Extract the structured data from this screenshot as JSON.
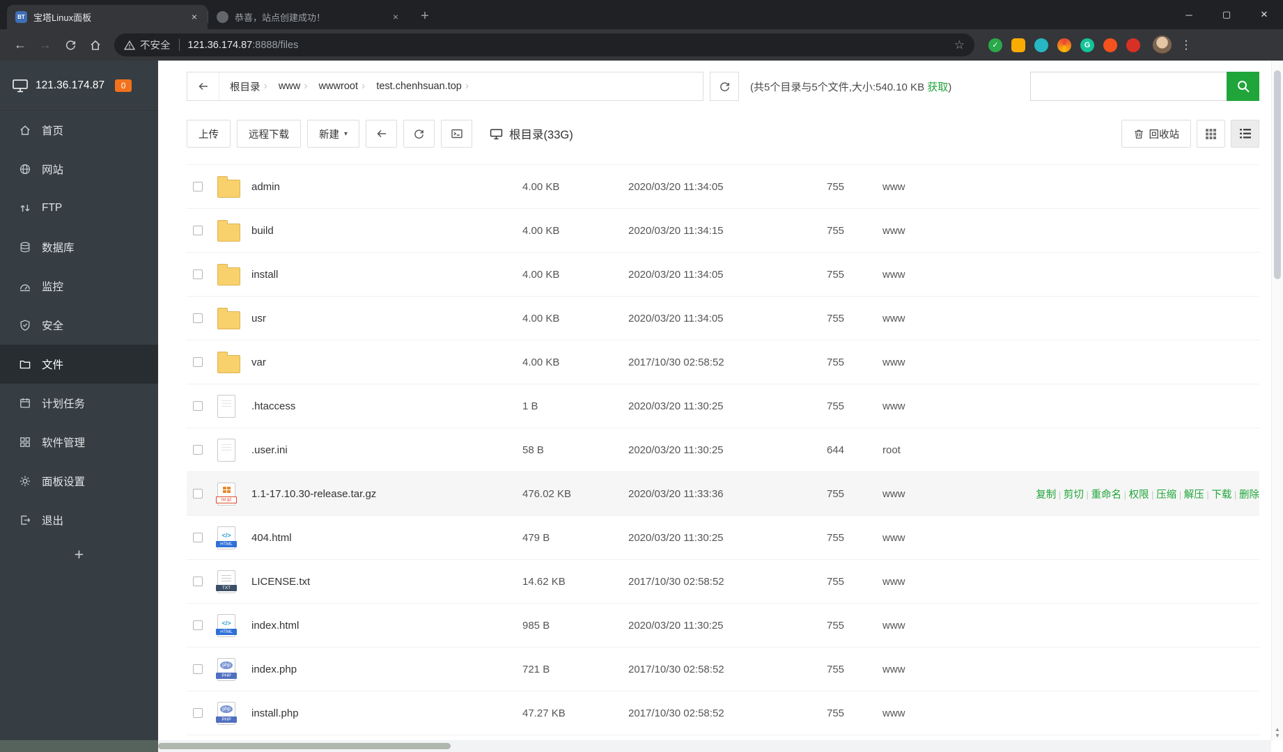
{
  "theme": {
    "accent_green": "#20a53a",
    "badge_orange": "#f2711c",
    "folder_yellow": "#f8d06c",
    "chrome_dark": "#202124",
    "sidebar_dark": "#373e43",
    "hover_row": "#f6f6f6"
  },
  "glyphs": {
    "back": "←",
    "forward": "→",
    "star": "☆",
    "kebab": "⋮",
    "minimize": "─",
    "maximize": "▢",
    "close": "✕",
    "tab_close": "×",
    "new_tab": "+",
    "caret": "▾",
    "crumb_sep": "›",
    "check": "✓",
    "g": "G",
    "bt": "BT",
    "scroll_up": "▲",
    "scroll_down": "▼"
  },
  "icons": {
    "search-icon": "magnifier",
    "recycle-icon": "trash-can",
    "not-secure-warning-icon": "triangle-exclamation",
    "grid-view-icon": "grid-3x3",
    "list-view-icon": "list-lines",
    "terminal-icon": "terminal-window",
    "disk-icon": "computer-drive",
    "refresh-icon": "circular-arrow"
  },
  "browser": {
    "tabs": [
      {
        "label": "宝塔Linux面板"
      },
      {
        "label": "恭喜，站点创建成功！"
      }
    ],
    "security_label": "不安全",
    "url_host": "121.36.174.87",
    "url_path": ":8888/files"
  },
  "sidebar": {
    "server_ip": "121.36.174.87",
    "message_count": "0",
    "items": [
      {
        "label": "首页"
      },
      {
        "label": "网站"
      },
      {
        "label": "FTP"
      },
      {
        "label": "数据库"
      },
      {
        "label": "监控"
      },
      {
        "label": "安全"
      },
      {
        "label": "文件"
      },
      {
        "label": "计划任务"
      },
      {
        "label": "软件管理"
      },
      {
        "label": "面板设置"
      },
      {
        "label": "退出"
      }
    ],
    "add_button": "+"
  },
  "pathbar": {
    "crumbs": [
      "根目录",
      "www",
      "wwwroot",
      "test.chenhsuan.top"
    ],
    "stats_prefix": "(共5个目录与5个文件,大小:540.10 KB ",
    "stats_link": "获取",
    "stats_suffix": ")"
  },
  "toolbar": {
    "upload": "上传",
    "remote_download": "远程下载",
    "new_menu": "新建",
    "root_disk": "根目录(33G)",
    "recycle_bin": "回收站"
  },
  "files": {
    "row_actions": [
      "复制",
      "剪切",
      "重命名",
      "权限",
      "压缩",
      "解压",
      "下载",
      "删除"
    ],
    "rows": [
      {
        "name": "admin",
        "size": "4.00 KB",
        "mtime": "2020/03/20 11:34:05",
        "perm": "755",
        "owner": "www"
      },
      {
        "name": "build",
        "size": "4.00 KB",
        "mtime": "2020/03/20 11:34:15",
        "perm": "755",
        "owner": "www"
      },
      {
        "name": "install",
        "size": "4.00 KB",
        "mtime": "2020/03/20 11:34:05",
        "perm": "755",
        "owner": "www"
      },
      {
        "name": "usr",
        "size": "4.00 KB",
        "mtime": "2020/03/20 11:34:05",
        "perm": "755",
        "owner": "www"
      },
      {
        "name": "var",
        "size": "4.00 KB",
        "mtime": "2017/10/30 02:58:52",
        "perm": "755",
        "owner": "www"
      },
      {
        "name": ".htaccess",
        "size": "1 B",
        "mtime": "2020/03/20 11:30:25",
        "perm": "755",
        "owner": "www"
      },
      {
        "name": ".user.ini",
        "size": "58 B",
        "mtime": "2020/03/20 11:30:25",
        "perm": "644",
        "owner": "root"
      },
      {
        "name": "1.1-17.10.30-release.tar.gz",
        "size": "476.02 KB",
        "mtime": "2020/03/20 11:33:36",
        "perm": "755",
        "owner": "www"
      },
      {
        "name": "404.html",
        "size": "479 B",
        "mtime": "2020/03/20 11:30:25",
        "perm": "755",
        "owner": "www"
      },
      {
        "name": "LICENSE.txt",
        "size": "14.62 KB",
        "mtime": "2017/10/30 02:58:52",
        "perm": "755",
        "owner": "www"
      },
      {
        "name": "index.html",
        "size": "985 B",
        "mtime": "2020/03/20 11:30:25",
        "perm": "755",
        "owner": "www"
      },
      {
        "name": "index.php",
        "size": "721 B",
        "mtime": "2017/10/30 02:58:52",
        "perm": "755",
        "owner": "www"
      },
      {
        "name": "install.php",
        "size": "47.27 KB",
        "mtime": "2017/10/30 02:58:52",
        "perm": "755",
        "owner": "www"
      }
    ]
  }
}
